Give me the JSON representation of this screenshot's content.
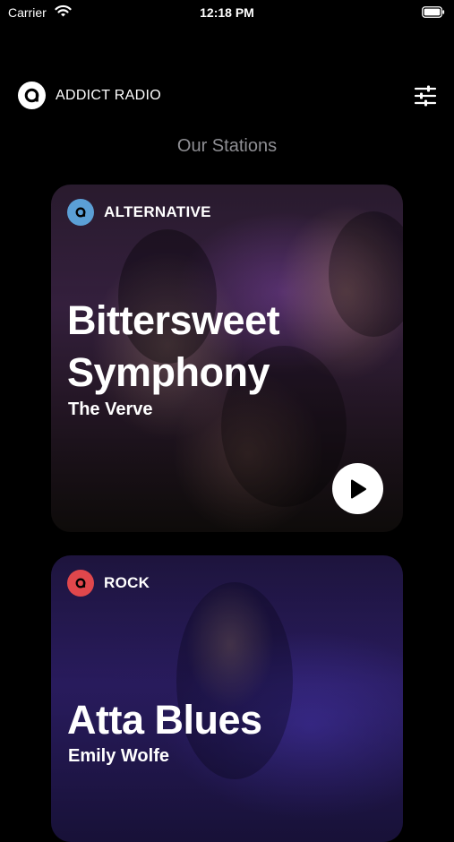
{
  "status_bar": {
    "carrier": "Carrier",
    "time": "12:18 PM"
  },
  "header": {
    "app_name": "ADDICT RADIO",
    "logo_icon": "addict-radio-logo-icon",
    "filter_icon": "sliders-icon"
  },
  "section_title": "Our Stations",
  "stations": [
    {
      "genre": "ALTERNATIVE",
      "genre_color": "#5b9fd6",
      "title_line1": "Bittersweet",
      "title_line2": "Symphony",
      "artist": "The Verve",
      "play_icon": "play-icon"
    },
    {
      "genre": "ROCK",
      "genre_color": "#e0474c",
      "title_line1": "Atta Blues",
      "artist": "Emily Wolfe"
    }
  ],
  "colors": {
    "background": "#000000",
    "section_title": "#8e8e93",
    "text": "#ffffff"
  }
}
